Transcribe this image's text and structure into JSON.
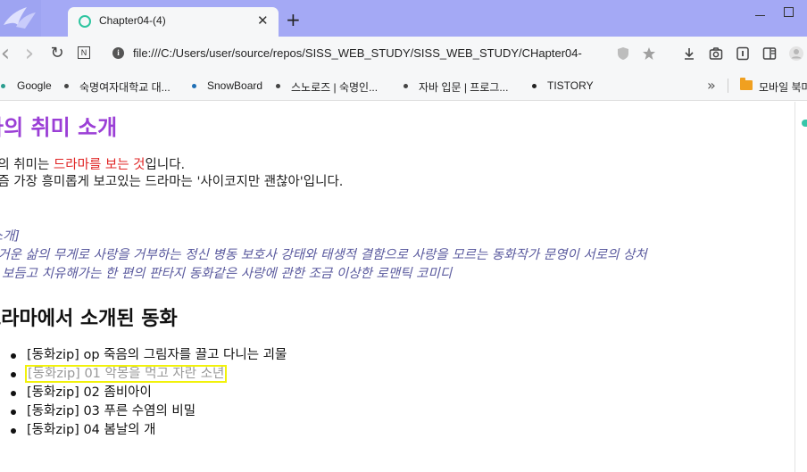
{
  "tab": {
    "title": "Chapter04-(4)",
    "close_glyph": "✕",
    "new_tab_glyph": "+"
  },
  "toolbar": {
    "back_glyph": "‹",
    "forward_glyph": "›",
    "reload_glyph": "↻",
    "n_label": "N",
    "url": "file:///C:/Users/user/source/repos/SISS_WEB_STUDY/SISS_WEB_STUDY/CHapter04-"
  },
  "bookmarks": {
    "items": [
      {
        "label": "Google",
        "dot_color": "#2a9d8f"
      },
      {
        "label": "숙명여자대학교 대...",
        "dot_color": "#444444"
      },
      {
        "label": "SnowBoard",
        "dot_color": "#1f6fb5"
      },
      {
        "label": "스노로즈 | 숙명인...",
        "dot_color": "#444444"
      },
      {
        "label": "자바 입문 | 프로그...",
        "dot_color": "#444444"
      },
      {
        "label": "TISTORY",
        "dot_color": "#222222"
      }
    ],
    "more_glyph": "»",
    "mobile_label": "모바일 북마"
  },
  "content": {
    "title": "나의 취미 소개",
    "intro_line1_prefix": "나의 취미는 ",
    "intro_line1_highlight": "드라마를 보는 것",
    "intro_line1_suffix": "입니다.",
    "intro_line2": "요즘 가장 흥미롭게 보고있는 드라마는 '사이코지만 괜찮아'입니다.",
    "synopsis_label": "[소개]",
    "synopsis_line1": "버거운 삶의 무게로 사랑을 거부하는 정신 병동 보호사 강태와 태생적 결함으로 사랑을 모르는 동화작가 문영이 서로의 상처",
    "synopsis_line2": "를 보듬고 치유해가는 한 편의 판타지 동화같은 사랑에 관한 조금 이상한 로맨틱 코미디",
    "section_title": "드라마에서 소개된 동화",
    "episodes": [
      "[동화zip] op 죽음의 그림자를 끌고 다니는 괴물",
      "[동화zip] 01 악몽을 먹고 자란 소년",
      "[동화zip] 02 좀비아이",
      "[동화zip] 03 푸른 수염의 비밀",
      "[동화zip] 04 봄날의 개"
    ]
  },
  "colors": {
    "titlebar": "#a4a9f5",
    "page_title": "#9b3fd6",
    "highlight": "#e02424",
    "synopsis": "#5a5a9e",
    "selection_outline": "#f2f20a"
  }
}
